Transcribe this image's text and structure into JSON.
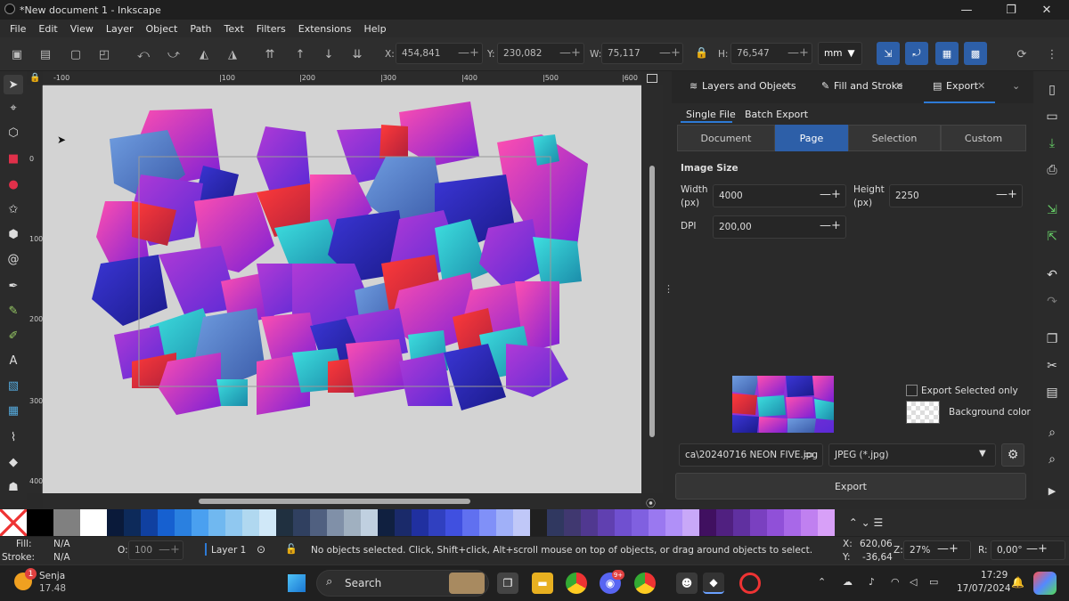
{
  "window": {
    "title": "*New document 1 - Inkscape",
    "min": "—",
    "max": "❐",
    "close": "✕"
  },
  "menu": [
    "File",
    "Edit",
    "View",
    "Layer",
    "Object",
    "Path",
    "Text",
    "Filters",
    "Extensions",
    "Help"
  ],
  "toolbar": {
    "x_label": "X:",
    "x_value": "454,841",
    "y_label": "Y:",
    "y_value": "230,082",
    "w_label": "W:",
    "w_value": "75,117",
    "h_label": "H:",
    "h_value": "76,547",
    "unit": "mm"
  },
  "ruler": {
    "top": [
      "-100",
      "|100",
      "|200",
      "|300",
      "|400",
      "|500",
      "|600"
    ],
    "left": [
      "0",
      "100",
      "200",
      "300",
      "400"
    ]
  },
  "panel": {
    "tabs": [
      "Layers and Objects",
      "Fill and Stroke",
      "Export"
    ],
    "subtabs": [
      "Single File",
      "Batch Export"
    ],
    "segments": [
      "Document",
      "Page",
      "Selection",
      "Custom"
    ],
    "image_size": "Image Size",
    "width_label": "Width",
    "width_unit": "(px)",
    "width_value": "4000",
    "height_label": "Height",
    "height_unit": "(px)",
    "height_value": "2250",
    "dpi_label": "DPI",
    "dpi_value": "200,00",
    "export_selected": "Export Selected only",
    "background_color": "Background color",
    "filename": "ca\\20240716 NEON FIVE.jpg",
    "format": "JPEG (*.jpg)",
    "export_button": "Export"
  },
  "status": {
    "fill_label": "Fill:",
    "fill_value": "N/A",
    "stroke_label": "Stroke:",
    "stroke_value": "N/A",
    "opacity_label": "O:",
    "opacity_value": "100",
    "layer": "Layer 1",
    "message": "No objects selected. Click, Shift+click, Alt+scroll mouse on top of objects, or drag around objects to select.",
    "x_label": "X:",
    "x_value": "620,06",
    "y_label": "Y:",
    "y_value": "-36,64",
    "zoom_label": "Z:",
    "zoom_value": "27%",
    "rot_label": "R:",
    "rot_value": "0,00°"
  },
  "taskbar": {
    "weather_temp": "17.48",
    "weather_name": "Senja",
    "weather_badge": "1",
    "search": "Search",
    "discord_badge": "9+",
    "time": "17:29",
    "date": "17/07/2024"
  },
  "colors": {
    "accent": "#2d5fa8",
    "canvas_bg": "#d3d3d3"
  }
}
